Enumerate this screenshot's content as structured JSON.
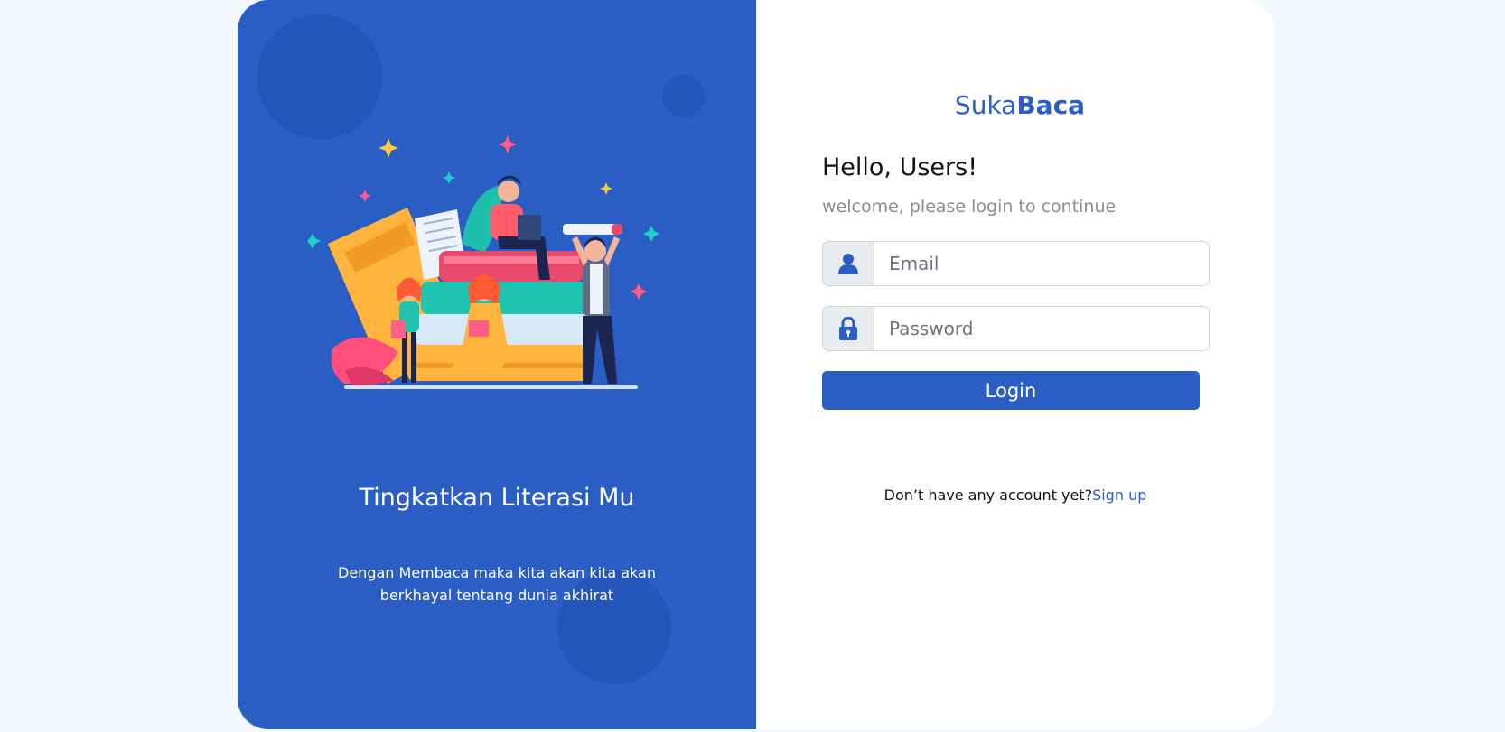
{
  "hero": {
    "title": "Tingkatkan Literasi Mu",
    "subtitle": "Dengan Membaca maka kita akan kita akan berkhayal tentang dunia akhirat"
  },
  "brand": {
    "part1": "Suka",
    "part2": "Baca"
  },
  "login": {
    "greeting": "Hello, Users!",
    "welcome": "welcome, please login to continue",
    "email_placeholder": "Email",
    "password_placeholder": "Password",
    "button_label": "Login",
    "signup_prompt": "Don’t have any account yet?",
    "signup_link": "Sign up"
  },
  "icons": {
    "email": "user-icon",
    "password": "lock-icon"
  },
  "colors": {
    "primary": "#2a5ec5",
    "background": "#f3f8fe"
  }
}
